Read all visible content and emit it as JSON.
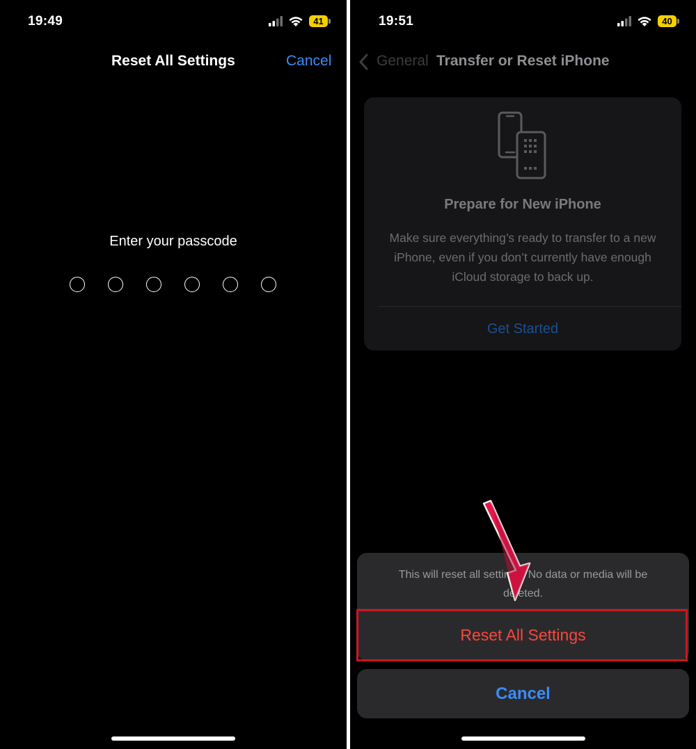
{
  "left_screen": {
    "status": {
      "time": "19:49",
      "battery": "41"
    },
    "nav": {
      "title": "Reset All Settings",
      "cancel_label": "Cancel"
    },
    "passcode": {
      "prompt": "Enter your passcode",
      "digits": 6
    }
  },
  "right_screen": {
    "status": {
      "time": "19:51",
      "battery": "40"
    },
    "nav": {
      "back_label": "General",
      "title": "Transfer or Reset iPhone"
    },
    "card": {
      "icon": "phones-transfer-icon",
      "title": "Prepare for New iPhone",
      "description": "Make sure everything’s ready to transfer to a new iPhone, even if you don’t currently have enough iCloud storage to back up.",
      "action_label": "Get Started"
    },
    "action_sheet": {
      "message": "This will reset all settings. No data or media will be deleted.",
      "destructive_label": "Reset All Settings",
      "cancel_label": "Cancel"
    }
  },
  "colors": {
    "accent_blue": "#3a8cf8",
    "destructive_red": "#ff453a",
    "highlight_red": "#d21420",
    "battery_yellow": "#f5d000",
    "annotation_arrow": "#e8174a"
  }
}
